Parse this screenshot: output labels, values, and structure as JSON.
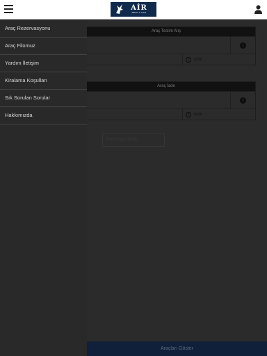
{
  "header": {
    "menu_icon": "hamburger-icon",
    "logo_text": "AİR",
    "logo_subtext": "RENT A CAR",
    "user_icon": "user-icon"
  },
  "drawer": {
    "items": [
      {
        "label": "Araç Rezervasyonu"
      },
      {
        "label": "Araç Filomuz"
      },
      {
        "label": "Yardım İletişim"
      },
      {
        "label": "Kiralama Koşulları"
      },
      {
        "label": "Sık Sorulan Sorular"
      },
      {
        "label": "Hakkımızda"
      }
    ]
  },
  "pickup": {
    "title": "Araç Teslim Alış",
    "time": "10:00"
  },
  "return": {
    "title": "Araç İade",
    "time": "10:00"
  },
  "promo": {
    "placeholder": "Promosyon Kodu"
  },
  "actions": {
    "show_cars": "Araçları Göster"
  },
  "colors": {
    "logo_background": "#102a4c",
    "bottom_button": "#11203a"
  }
}
